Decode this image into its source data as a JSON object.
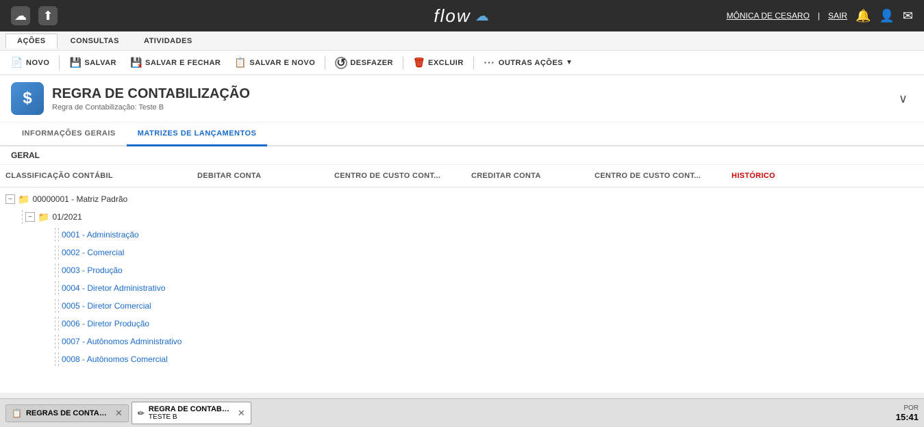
{
  "app": {
    "name": "flow",
    "cloud_icon": "☁"
  },
  "topbar": {
    "user": "MÔNICA DE CESARO",
    "logout": "SAIR",
    "separator": "|"
  },
  "menubar": {
    "items": [
      "AÇÕES",
      "CONSULTAS",
      "ATIVIDADES"
    ],
    "active": "AÇÕES"
  },
  "toolbar": {
    "buttons": [
      {
        "id": "novo",
        "label": "NOVO",
        "icon": "📄"
      },
      {
        "id": "salvar",
        "label": "SALVAR",
        "icon": "💾"
      },
      {
        "id": "salvar-fechar",
        "label": "SALVAR E FECHAR",
        "icon": "💾"
      },
      {
        "id": "salvar-novo",
        "label": "SALVAR E NOVO",
        "icon": "📋"
      },
      {
        "id": "desfazer",
        "label": "DESFAZER",
        "icon": "↩"
      },
      {
        "id": "excluir",
        "label": "EXCLUIR",
        "icon": "🗑"
      },
      {
        "id": "outras-acoes",
        "label": "OUTRAS AÇÕES",
        "icon": "···"
      }
    ]
  },
  "page": {
    "icon": "$",
    "title": "REGRA DE CONTABILIZAÇÃO",
    "subtitle": "Regra de Contabilização: Teste B"
  },
  "tabs": [
    {
      "id": "info-gerais",
      "label": "INFORMAÇÕES GERAIS",
      "active": false
    },
    {
      "id": "matrizes",
      "label": "MATRIZES DE LANÇAMENTOS",
      "active": true
    }
  ],
  "section_header": "GERAL",
  "table": {
    "columns": [
      {
        "id": "classificacao",
        "label": "CLASSIFICAÇÃO CONTÁBIL",
        "red": false
      },
      {
        "id": "debitar",
        "label": "DEBITAR CONTA",
        "red": false
      },
      {
        "id": "custo-cont-deb",
        "label": "CENTRO DE CUSTO CONT...",
        "red": false
      },
      {
        "id": "creditar",
        "label": "CREDITAR CONTA",
        "red": false
      },
      {
        "id": "custo-cont-cred",
        "label": "CENTRO DE CUSTO CONT...",
        "red": false
      },
      {
        "id": "historico",
        "label": "HISTÓRICO",
        "red": true
      }
    ]
  },
  "tree": {
    "items": [
      {
        "level": 0,
        "type": "folder",
        "toggleable": true,
        "label": "00000001 - Matriz Padrão"
      },
      {
        "level": 1,
        "type": "folder",
        "toggleable": true,
        "label": "01/2021"
      },
      {
        "level": 2,
        "type": "item",
        "label": "0001 - Administração"
      },
      {
        "level": 2,
        "type": "item",
        "label": "0002 - Comercial"
      },
      {
        "level": 2,
        "type": "item",
        "label": "0003 - Produção"
      },
      {
        "level": 2,
        "type": "item",
        "label": "0004 - Diretor Administrativo"
      },
      {
        "level": 2,
        "type": "item",
        "label": "0005 - Diretor Comercial"
      },
      {
        "level": 2,
        "type": "item",
        "label": "0006 - Diretor Produção"
      },
      {
        "level": 2,
        "type": "item",
        "label": "0007 - Autônomos Administrativo"
      },
      {
        "level": 2,
        "type": "item",
        "label": "0008 - Autônomos Comercial"
      }
    ]
  },
  "taskbar": {
    "items": [
      {
        "id": "regras-contabiliz",
        "label": "REGRAS DE CONTABILIZ...",
        "active": false,
        "closable": true
      },
      {
        "id": "regra-contabili-b",
        "label": "REGRA DE CONTABILI...\nTESTE B",
        "line1": "REGRA DE CONTABILI...",
        "line2": "TESTE B",
        "active": true,
        "closable": true,
        "has_pencil": true
      }
    ],
    "time": "15:41",
    "date": "POR"
  }
}
